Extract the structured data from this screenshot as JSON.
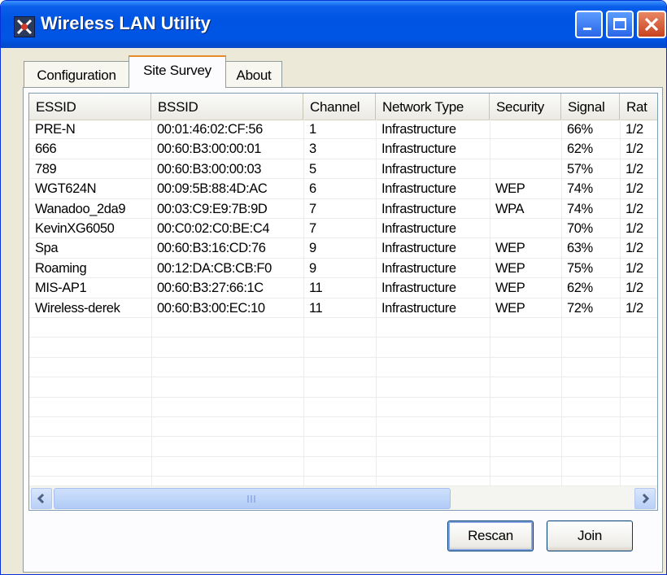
{
  "window": {
    "title": "Wireless LAN Utility"
  },
  "tabs": [
    {
      "label": "Configuration",
      "selected": false
    },
    {
      "label": "Site Survey",
      "selected": true
    },
    {
      "label": "About",
      "selected": false
    }
  ],
  "list": {
    "columns": [
      "ESSID",
      "BSSID",
      "Channel",
      "Network Type",
      "Security",
      "Signal",
      "Rat"
    ],
    "rows": [
      [
        "PRE-N",
        "00:01:46:02:CF:56",
        "1",
        "Infrastructure",
        "",
        "66%",
        "1/2"
      ],
      [
        "666",
        "00:60:B3:00:00:01",
        "3",
        "Infrastructure",
        "",
        "62%",
        "1/2"
      ],
      [
        "789",
        "00:60:B3:00:00:03",
        "5",
        "Infrastructure",
        "",
        "57%",
        "1/2"
      ],
      [
        "WGT624N",
        "00:09:5B:88:4D:AC",
        "6",
        "Infrastructure",
        "WEP",
        "74%",
        "1/2"
      ],
      [
        "Wanadoo_2da9",
        "00:03:C9:E9:7B:9D",
        "7",
        "Infrastructure",
        "WPA",
        "74%",
        "1/2"
      ],
      [
        "KevinXG6050",
        "00:C0:02:C0:BE:C4",
        "7",
        "Infrastructure",
        "",
        "70%",
        "1/2"
      ],
      [
        "Spa",
        "00:60:B3:16:CD:76",
        "9",
        "Infrastructure",
        "WEP",
        "63%",
        "1/2"
      ],
      [
        "Roaming",
        "00:12:DA:CB:CB:F0",
        "9",
        "Infrastructure",
        "WEP",
        "75%",
        "1/2"
      ],
      [
        "MIS-AP1",
        "00:60:B3:27:66:1C",
        "11",
        "Infrastructure",
        "WEP",
        "62%",
        "1/2"
      ],
      [
        "Wireless-derek",
        "00:60:B3:00:EC:10",
        "11",
        "Infrastructure",
        "WEP",
        "72%",
        "1/2"
      ]
    ]
  },
  "scrollbar": {
    "left_icon": "scroll-left-arrow",
    "right_icon": "scroll-right-arrow"
  },
  "buttons": {
    "rescan": "Rescan",
    "join": "Join"
  },
  "colors": {
    "titlebar": "#0054e3",
    "window_bg": "#ece9d8",
    "close_button": "#c8431f",
    "active_tab_accent": "#e68b2c"
  }
}
